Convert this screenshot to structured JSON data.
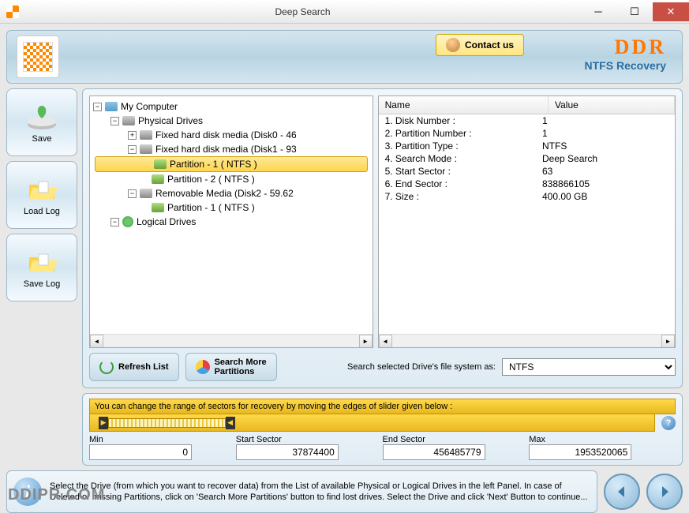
{
  "window": {
    "title": "Deep Search"
  },
  "header": {
    "contact_label": "Contact us",
    "brand": "DDR",
    "brand_sub": "NTFS Recovery"
  },
  "sidebar": {
    "save": "Save",
    "load_log": "Load Log",
    "save_log": "Save Log"
  },
  "tree": {
    "root": "My Computer",
    "physical": "Physical Drives",
    "disk0": "Fixed hard disk media (Disk0 - 46",
    "disk1": "Fixed hard disk media (Disk1 - 93",
    "disk1_p1": "Partition - 1 ( NTFS )",
    "disk1_p2": "Partition - 2 ( NTFS )",
    "disk2": "Removable Media (Disk2 - 59.62",
    "disk2_p1": "Partition - 1 ( NTFS )",
    "logical": "Logical Drives"
  },
  "details": {
    "header_name": "Name",
    "header_value": "Value",
    "rows": [
      {
        "name": "1. Disk Number :",
        "value": "1"
      },
      {
        "name": "2. Partition Number :",
        "value": "1"
      },
      {
        "name": "3. Partition Type :",
        "value": "NTFS"
      },
      {
        "name": "4. Search Mode :",
        "value": "Deep Search"
      },
      {
        "name": "5. Start Sector :",
        "value": "63"
      },
      {
        "name": "6. End Sector :",
        "value": "838866105"
      },
      {
        "name": "7. Size :",
        "value": "400.00 GB"
      }
    ]
  },
  "controls": {
    "refresh": "Refresh List",
    "search_more": "Search More\nPartitions",
    "fs_label": "Search selected Drive's file system as:",
    "fs_value": "NTFS"
  },
  "slider": {
    "hint": "You can change the range of sectors for recovery by moving the edges of slider given below :",
    "min_label": "Min",
    "min_value": "0",
    "start_label": "Start Sector",
    "start_value": "37874400",
    "end_label": "End Sector",
    "end_value": "456485779",
    "max_label": "Max",
    "max_value": "1953520065"
  },
  "footer": {
    "info": "Select the Drive (from which you want to recover data) from the List of available Physical or Logical Drives in the left Panel. In case of Deleted or missing Partitions, click on 'Search More Partitions' button to find lost drives. Select the Drive and click 'Next' Button to continue..."
  },
  "watermark": "DDIPR.COM"
}
